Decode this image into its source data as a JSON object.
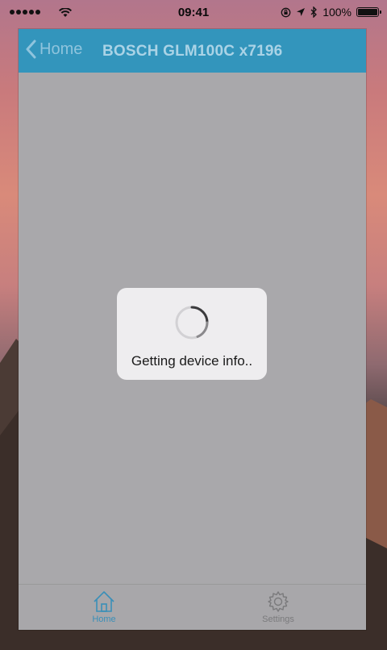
{
  "status_bar": {
    "time": "09:41",
    "battery_percent": "100%",
    "battery_level": 1.0,
    "signal_bars": 5
  },
  "nav": {
    "back_label": "Home",
    "title": "BOSCH GLM100C x7196"
  },
  "loading": {
    "message": "Getting device info.."
  },
  "tabs": [
    {
      "label": "Home",
      "icon": "home-icon",
      "selected": true
    },
    {
      "label": "Settings",
      "icon": "gear-icon",
      "selected": false
    }
  ],
  "colors": {
    "nav_background": "#3395bc",
    "tab_selected": "#3a8fb8",
    "tab_unselected": "#7a7a7c",
    "overlay": "#a9a8ab"
  }
}
